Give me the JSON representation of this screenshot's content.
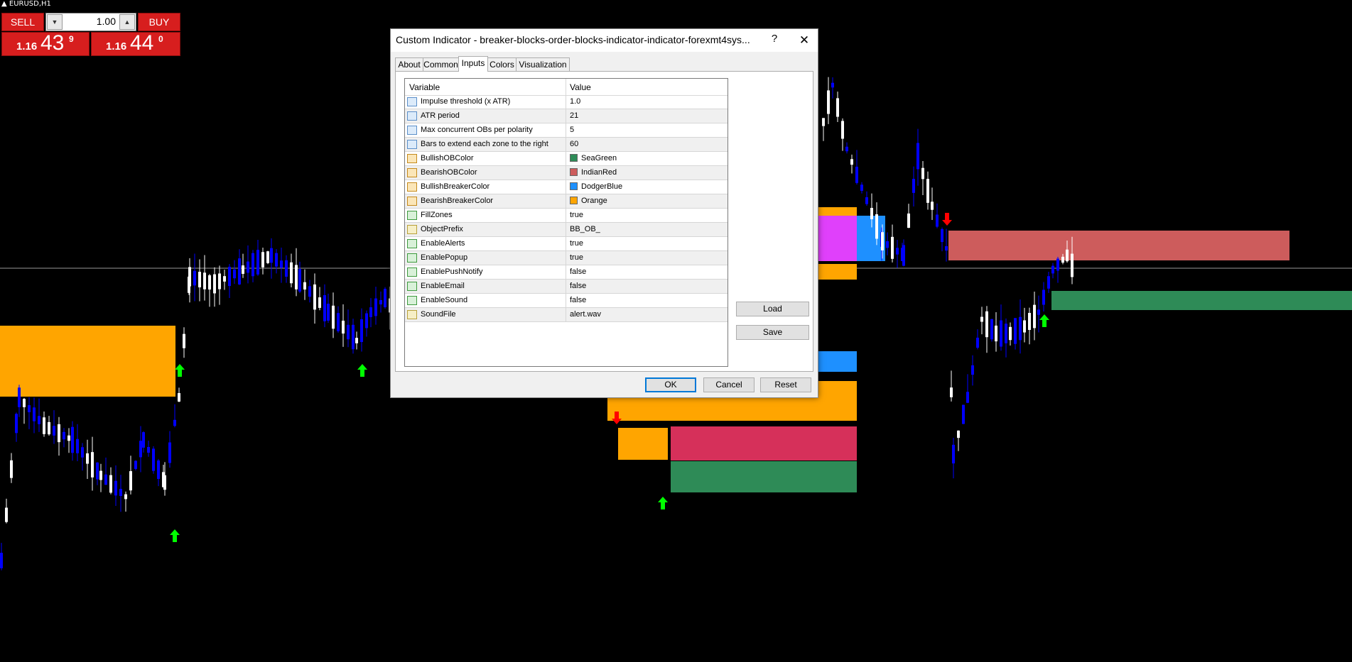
{
  "chart": {
    "symbol": "EURUSD,H1",
    "colors": {
      "background": "#000000",
      "bull_candle": "#ffffff",
      "bear_candle": "#0000ff",
      "orange_zone": "#ffa500",
      "seagreen_zone": "#2e8b57",
      "indianred_zone": "#cd5c5c",
      "crimson_zone": "#d6305a",
      "dodgerblue_zone": "#1e90ff",
      "magenta_zone": "#e040fb",
      "up_arrow": "#00ff00",
      "down_arrow": "#ff0000",
      "price_line": "#c0c0c0"
    }
  },
  "trade_panel": {
    "sell_label": "SELL",
    "buy_label": "BUY",
    "lot": "1.00",
    "lot_down": "▼",
    "lot_up": "▲",
    "bid_small": "1.16",
    "bid_big": "43",
    "bid_sup": "9",
    "ask_small": "1.16",
    "ask_big": "44",
    "ask_sup": "0"
  },
  "dialog": {
    "title": "Custom Indicator - breaker-blocks-order-blocks-indicator-indicator-forexmt4sys...",
    "help": "?",
    "close": "✕",
    "tabs": [
      "About",
      "Common",
      "Inputs",
      "Colors",
      "Visualization"
    ],
    "active_tab": "Inputs",
    "columns": {
      "variable": "Variable",
      "value": "Value"
    },
    "inputs": [
      {
        "icon": "1/2",
        "name": "Impulse threshold (x ATR)",
        "value": "1.0"
      },
      {
        "icon": "123",
        "name": "ATR period",
        "value": "21"
      },
      {
        "icon": "123",
        "name": "Max concurrent OBs per polarity",
        "value": "5"
      },
      {
        "icon": "123",
        "name": "Bars to extend each zone to the right",
        "value": "60"
      },
      {
        "icon": "col",
        "name": "BullishOBColor",
        "value": "SeaGreen",
        "color": "#2e8b57"
      },
      {
        "icon": "col",
        "name": "BearishOBColor",
        "value": "IndianRed",
        "color": "#cd5c5c"
      },
      {
        "icon": "col",
        "name": "BullishBreakerColor",
        "value": "DodgerBlue",
        "color": "#1e90ff"
      },
      {
        "icon": "col",
        "name": "BearishBreakerColor",
        "value": "Orange",
        "color": "#ffa500"
      },
      {
        "icon": "bool",
        "name": "FillZones",
        "value": "true"
      },
      {
        "icon": "ab",
        "name": "ObjectPrefix",
        "value": "BB_OB_"
      },
      {
        "icon": "bool",
        "name": "EnableAlerts",
        "value": "true"
      },
      {
        "icon": "bool",
        "name": "EnablePopup",
        "value": "true"
      },
      {
        "icon": "bool",
        "name": "EnablePushNotify",
        "value": "false"
      },
      {
        "icon": "bool",
        "name": "EnableEmail",
        "value": "false"
      },
      {
        "icon": "bool",
        "name": "EnableSound",
        "value": "false"
      },
      {
        "icon": "ab",
        "name": "SoundFile",
        "value": "alert.wav"
      }
    ],
    "buttons": {
      "load": "Load",
      "save": "Save",
      "ok": "OK",
      "cancel": "Cancel",
      "reset": "Reset"
    }
  }
}
